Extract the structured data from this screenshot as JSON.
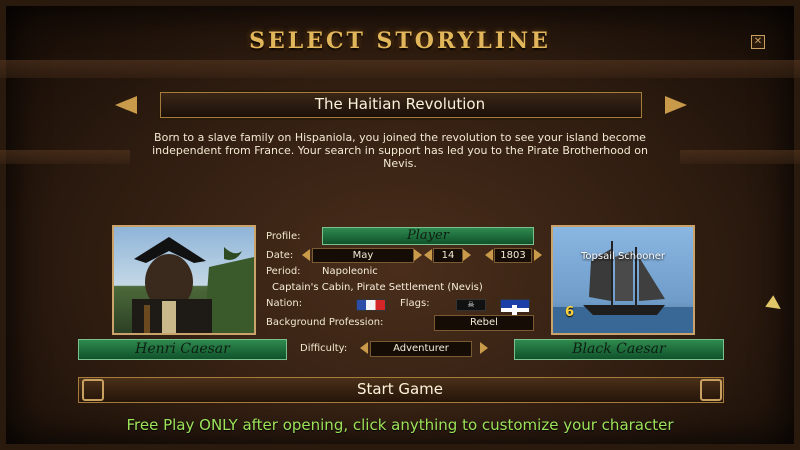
{
  "window": {
    "title": "SELECT STORYLINE",
    "close_icon": "close-icon"
  },
  "storyline": {
    "title": "The Haitian Revolution",
    "description": "Born to a slave family on Hispaniola, you joined the revolution to see your island become independent from France. Your search in support has led you to the Pirate Brotherhood on Nevis."
  },
  "profile": {
    "label": "Profile:",
    "value": "Player",
    "date_label": "Date:",
    "month": "May",
    "day": "14",
    "year": "1803",
    "period_label": "Period:",
    "period": "Napoleonic",
    "location": "Captain's Cabin, Pirate Settlement (Nevis)",
    "nation_label": "Nation:",
    "flags_label": "Flags:",
    "background_label": "Background Profession:",
    "background": "Rebel",
    "difficulty_label": "Difficulty:",
    "difficulty": "Adventurer"
  },
  "character": {
    "name": "Henri Caesar"
  },
  "ship": {
    "type": "Topsail Schooner",
    "class_number": "6",
    "name": "Black Caesar"
  },
  "start_button": "Start Game",
  "footer_hint": "Free Play ONLY after opening, click anything to customize your character",
  "colors": {
    "title_gold": "#e2b65a",
    "hint_green": "#9ce35a",
    "panel_green": "#2f8a4f"
  }
}
